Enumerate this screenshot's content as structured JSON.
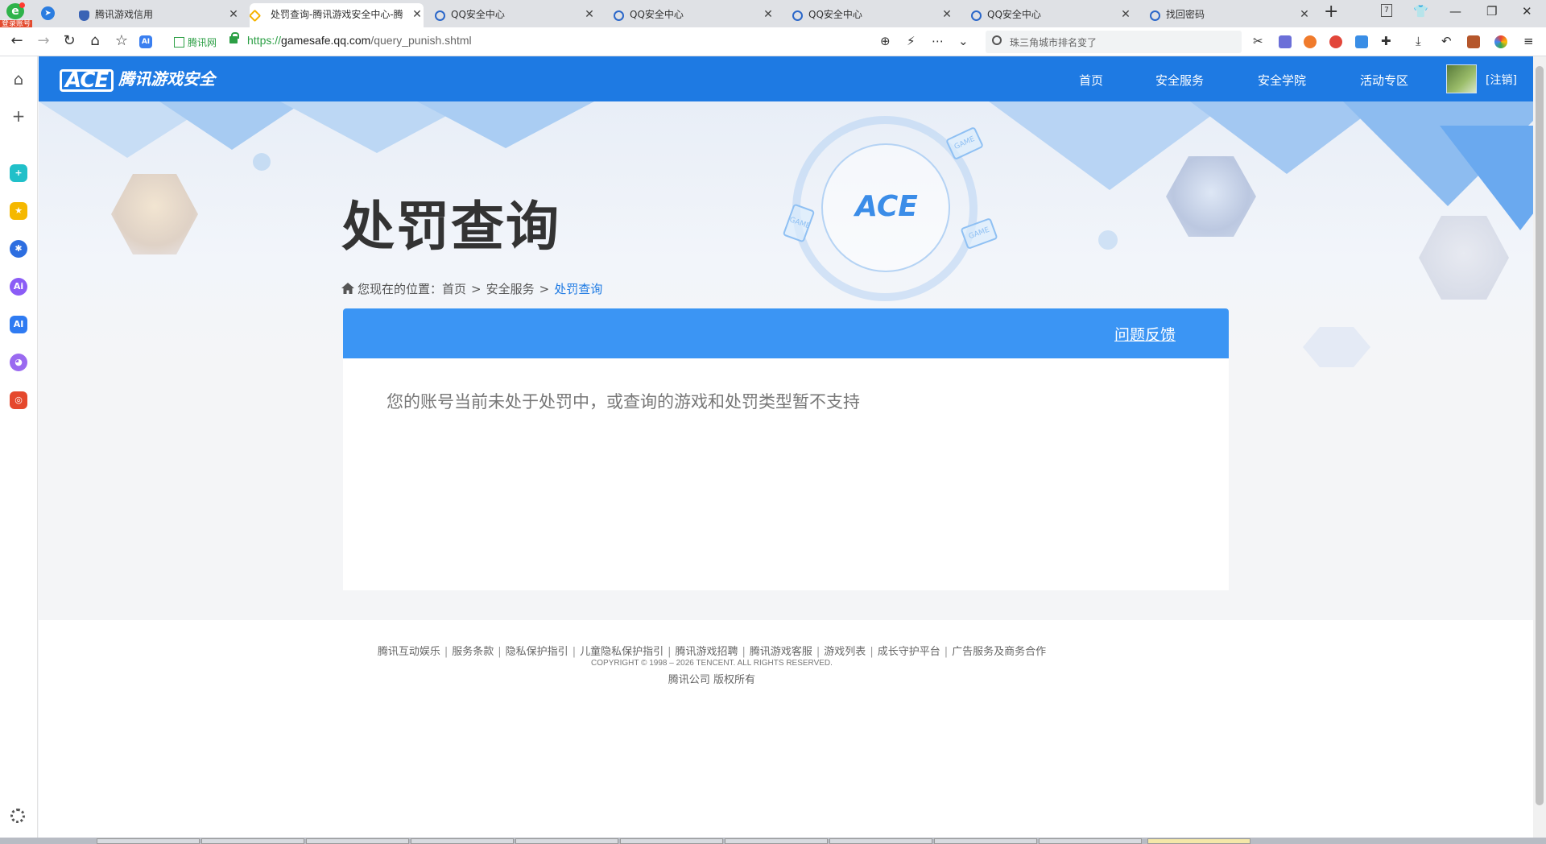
{
  "browser": {
    "badge_label": "登录账号",
    "tabs": [
      {
        "title": "腾讯游戏信用",
        "icon": "shield-icon"
      },
      {
        "title": "处罚查询-腾讯游戏安全中心-腾",
        "icon": "ace-icon",
        "active": true
      },
      {
        "title": "QQ安全中心",
        "icon": "qq-shield-icon"
      },
      {
        "title": "QQ安全中心",
        "icon": "qq-shield-icon"
      },
      {
        "title": "QQ安全中心",
        "icon": "qq-shield-icon"
      },
      {
        "title": "QQ安全中心",
        "icon": "qq-shield-icon"
      },
      {
        "title": "找回密码",
        "icon": "qq-shield-icon"
      }
    ],
    "tab_counter": "7",
    "site_badge": "腾讯网",
    "url": {
      "protocol": "https://",
      "host": "gamesafe.qq.com",
      "path": "/query_punish.shtml"
    },
    "search_placeholder": "珠三角城市排名变了"
  },
  "header": {
    "logo_mark": "ACE",
    "logo_name": "腾讯游戏安全",
    "nav": [
      "首页",
      "安全服务",
      "安全学院",
      "活动专区"
    ],
    "logout": "[注销]"
  },
  "banner": {
    "emblem": "ACE",
    "card_label": "GAME"
  },
  "main": {
    "title": "处罚查询",
    "breadcrumb": {
      "prefix": "您现在的位置：",
      "items": [
        "首页",
        "安全服务",
        "处罚查询"
      ],
      "separator": ">"
    },
    "feedback": "问题反馈",
    "result_message": "您的账号当前未处于处罚中，或查询的游戏和处罚类型暂不支持"
  },
  "footer": {
    "links": [
      "腾讯互动娱乐",
      "服务条款",
      "隐私保护指引",
      "儿童隐私保护指引",
      "腾讯游戏招聘",
      "腾讯游戏客服",
      "游戏列表",
      "成长守护平台",
      "广告服务及商务合作"
    ],
    "copyright": "COPYRIGHT © 1998 – 2026 TENCENT. ALL RIGHTS RESERVED.",
    "rights": "腾讯公司 版权所有"
  },
  "colors": {
    "nav_blue": "#1e7ae3",
    "card_head_blue": "#3b95f4",
    "secure_green": "#2c9f45"
  }
}
